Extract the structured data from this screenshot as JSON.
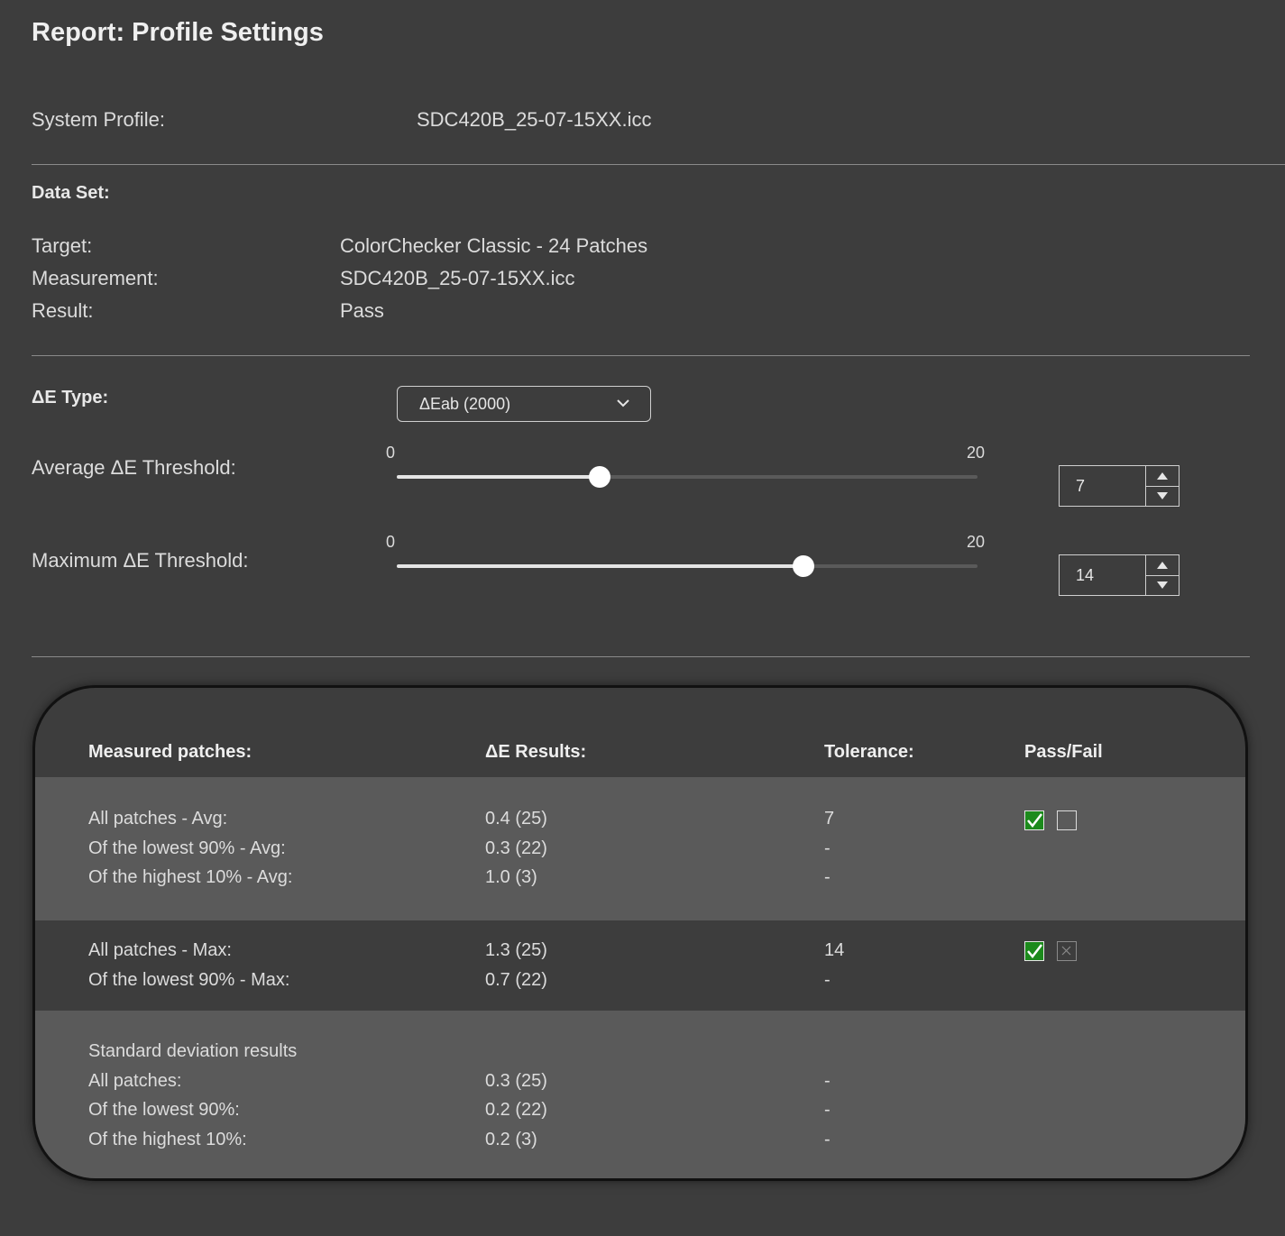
{
  "title": "Report: Profile Settings",
  "system_profile": {
    "label": "System Profile:",
    "value": "SDC420B_25-07-15XX.icc"
  },
  "data_set": {
    "heading": "Data Set:",
    "target_label": "Target:",
    "target_value": "ColorChecker Classic - 24 Patches",
    "measurement_label": "Measurement:",
    "measurement_value": "SDC420B_25-07-15XX.icc",
    "result_label": "Result:",
    "result_value": "Pass"
  },
  "de_type": {
    "label": "ΔE Type:",
    "selected": "ΔEab (2000)",
    "icon": "chevron-down-icon"
  },
  "avg_threshold": {
    "label": "Average ΔE Threshold:",
    "min": "0",
    "max": "20",
    "value": "7",
    "fraction": 0.35
  },
  "max_threshold": {
    "label": "Maximum ΔE Threshold:",
    "min": "0",
    "max": "20",
    "value": "14",
    "fraction": 0.7
  },
  "results": {
    "headers": {
      "patches": "Measured patches:",
      "results": "ΔE Results:",
      "tolerance": "Tolerance:",
      "passfail": "Pass/Fail"
    },
    "avg": {
      "labels": [
        "All patches - Avg:",
        "Of the lowest 90% - Avg:",
        "Of the highest 10% - Avg:"
      ],
      "values": [
        "0.4 (25)",
        "0.3 (22)",
        "1.0 (3)"
      ],
      "tolerance": [
        "7",
        "-",
        "-"
      ],
      "pass": true,
      "fail": false
    },
    "max": {
      "labels": [
        "All patches - Max:",
        "Of the lowest 90% - Max:"
      ],
      "values": [
        "1.3 (25)",
        "0.7 (22)"
      ],
      "tolerance": [
        "14",
        "-"
      ],
      "pass": true,
      "fail": false
    },
    "std": {
      "heading": "Standard deviation results",
      "labels": [
        "All patches:",
        "Of the lowest 90%:",
        "Of the highest 10%:"
      ],
      "values": [
        "0.3 (25)",
        "0.2 (22)",
        "0.2 (3)"
      ],
      "tolerance": [
        "-",
        "-",
        "-"
      ]
    }
  },
  "colors": {
    "background": "#3d3d3d",
    "band_light": "#5a5a5a",
    "pass_green": "#1c8a1c"
  }
}
